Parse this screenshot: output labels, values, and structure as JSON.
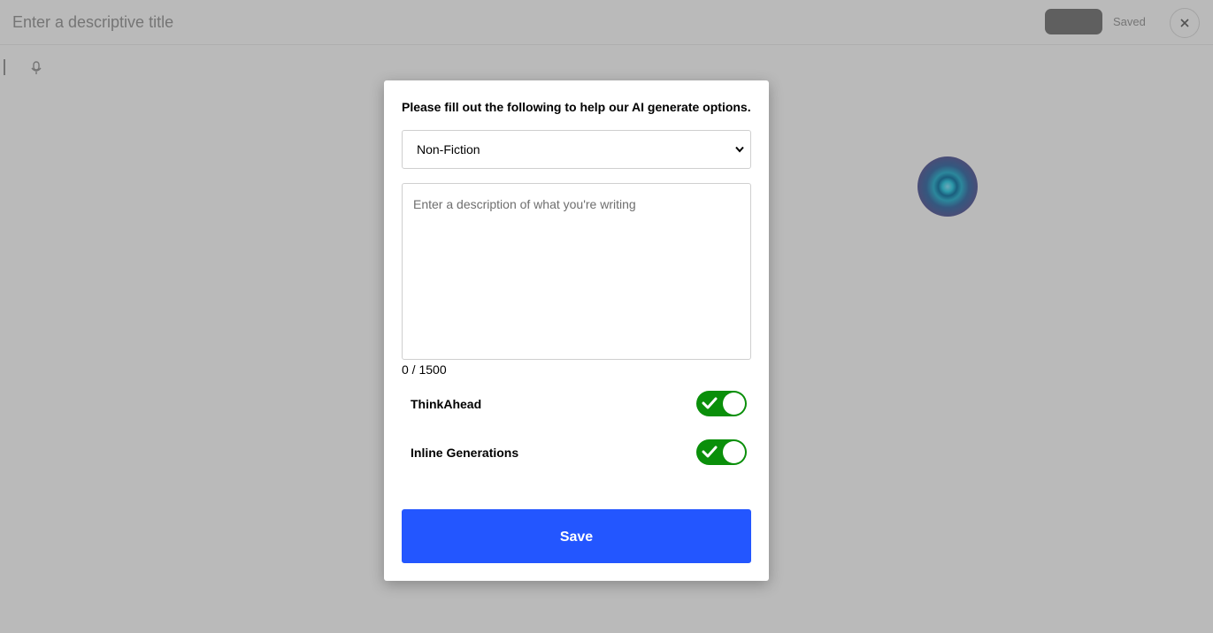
{
  "app": {
    "title_placeholder": "Enter a descriptive title",
    "save_status": "Saved"
  },
  "modal": {
    "heading": "Please fill out the following to help our AI generate options.",
    "genre": {
      "selected": "Non-Fiction"
    },
    "description": {
      "placeholder": "Enter a description of what you're writing",
      "value": ""
    },
    "char_count": "0 / 1500",
    "toggles": [
      {
        "label": "ThinkAhead",
        "on": true
      },
      {
        "label": "Inline Generations",
        "on": true
      }
    ],
    "save_label": "Save"
  },
  "colors": {
    "accent": "#2356ff",
    "toggle_on": "#0a8f0a"
  },
  "icons": [
    "close-icon",
    "chevron-down-icon",
    "checkmark-icon",
    "ai-orb-icon"
  ]
}
